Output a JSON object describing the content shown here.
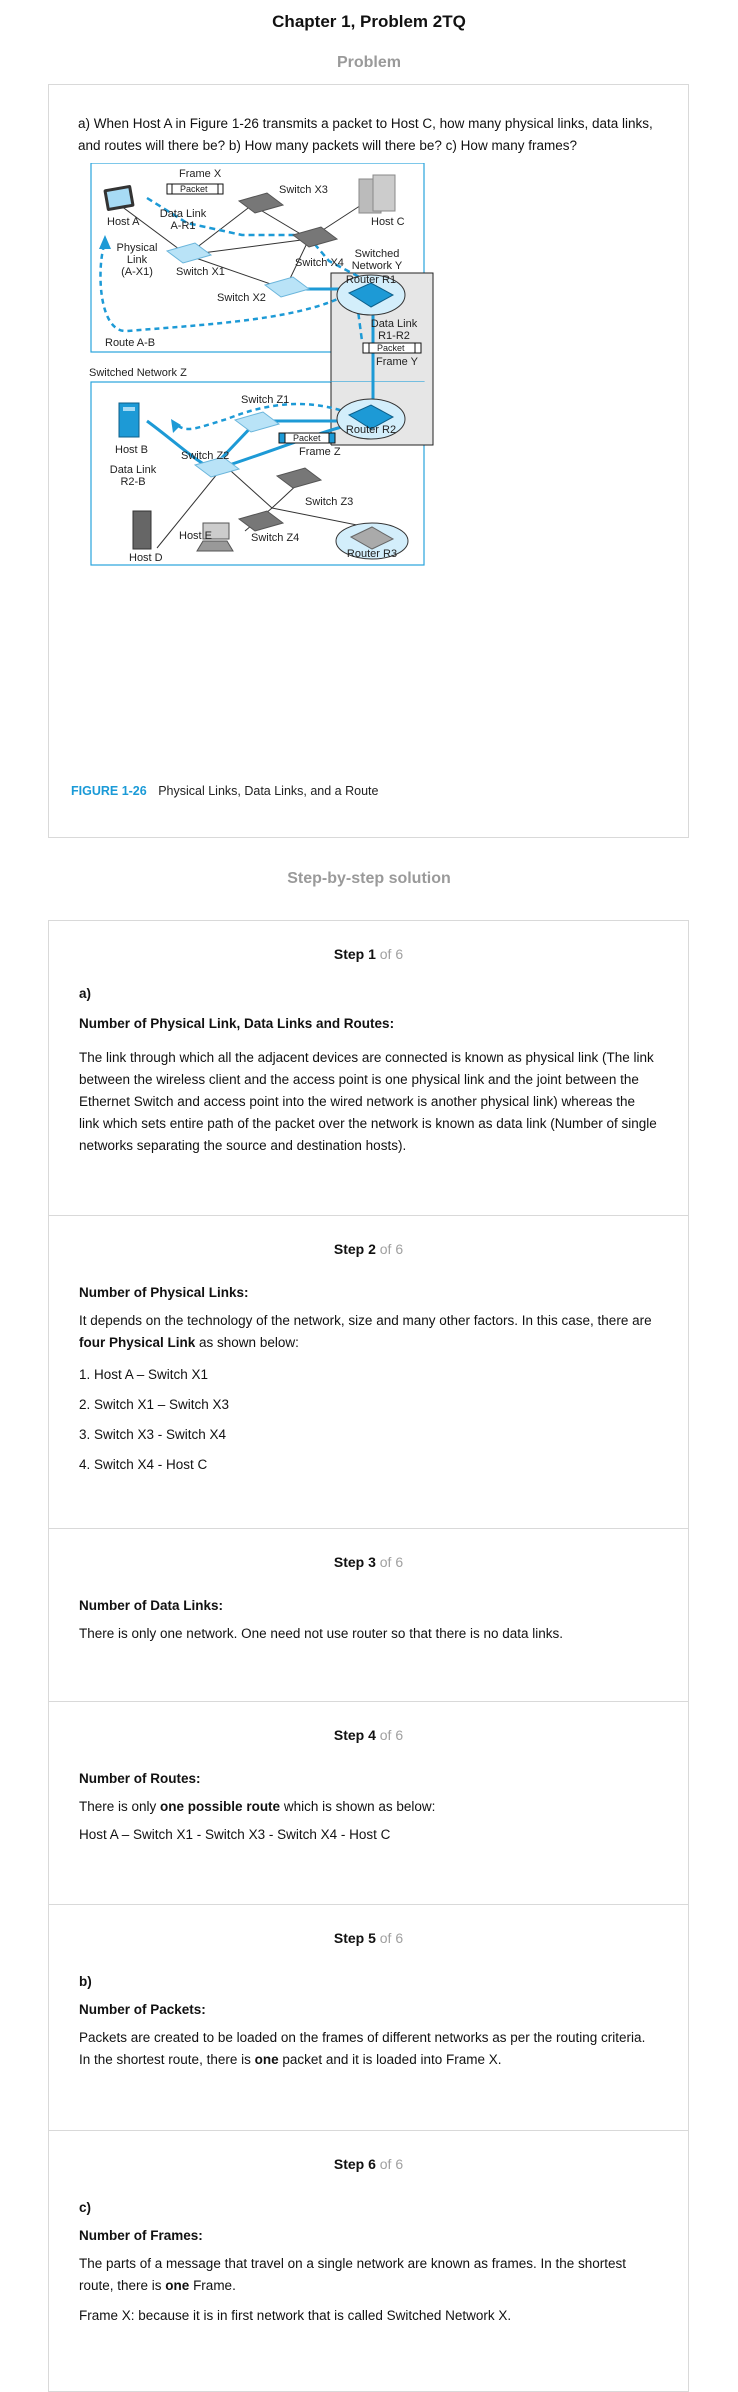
{
  "page_title": "Chapter 1, Problem 2TQ",
  "problem_heading": "Problem",
  "problem_text": "a) When Host A in Figure 1-26 transmits a packet to Host C, how many physical links, data links, and routes will there be? b) How many packets will there be? c) How many frames?",
  "figure": {
    "caption_number": "FIGURE 1-26",
    "caption_text": "Physical Links, Data Links, and a Route",
    "labels": {
      "frame_x": "Frame X",
      "packet": "Packet",
      "switch_x3": "Switch X3",
      "host_c": "Host C",
      "host_a": "Host A",
      "data_link_ar1_l1": "Data Link",
      "data_link_ar1_l2": "A-R1",
      "physical_link_l1": "Physical",
      "physical_link_l2": "Link",
      "physical_link_l3": "(A-X1)",
      "switch_x1": "Switch X1",
      "switch_x4": "Switch X4",
      "switched_network_y_l1": "Switched",
      "switched_network_y_l2": "Network Y",
      "router_r1": "Router R1",
      "switch_x2": "Switch X2",
      "data_link_r1r2_l1": "Data Link",
      "data_link_r1r2_l2": "R1-R2",
      "frame_y": "Frame Y",
      "route_ab": "Route A-B",
      "switched_network_z": "Switched Network Z",
      "switch_z1": "Switch Z1",
      "router_r2": "Router R2",
      "host_b": "Host B",
      "switch_z2": "Switch Z2",
      "frame_z": "Frame Z",
      "data_link_r2b_l1": "Data Link",
      "data_link_r2b_l2": "R2-B",
      "switch_z3": "Switch Z3",
      "host_e": "Host E",
      "switch_z4": "Switch Z4",
      "host_d": "Host D",
      "router_r3": "Router R3"
    }
  },
  "solution_heading": "Step-by-step solution",
  "step_of": "of 6",
  "steps": [
    {
      "title": "Step 1",
      "part": "a)",
      "heading": "Number of Physical Link, Data Links and Routes:",
      "text": "The link through which all the adjacent devices are connected is known as physical link (The link between the wireless client and the access point is one physical link and the joint between the Ethernet Switch and access point into the wired network is another physical link) whereas the link which sets entire path of the packet over the network is known as data link (Number of single networks separating the source and destination hosts)."
    },
    {
      "title": "Step 2",
      "heading": "Number of Physical Links:",
      "text_before": "It depends on the technology of the network, size and many other factors. In this case, there are ",
      "text_bold": "four Physical Link",
      "text_after": " as shown below:",
      "items": [
        "1. Host A – Switch X1",
        "2. Switch X1 – Switch X3",
        "3. Switch X3 - Switch X4",
        "4. Switch X4 - Host C"
      ]
    },
    {
      "title": "Step 3",
      "heading": "Number of Data Links:",
      "text": "There is only one network. One need not use router so that there is no data links."
    },
    {
      "title": "Step 4",
      "heading": "Number of Routes:",
      "text_before": "There is only ",
      "text_bold": "one possible route",
      "text_after": " which is shown as below:",
      "route": "Host A – Switch X1 - Switch X3 - Switch X4 - Host C"
    },
    {
      "title": "Step 5",
      "part": "b)",
      "heading": "Number of Packets:",
      "text_before": "Packets are created to be loaded on the frames of different networks as per the routing criteria. In the shortest route, there is ",
      "text_bold": "one",
      "text_after": " packet and it is loaded into Frame X."
    },
    {
      "title": "Step 6",
      "part": "c)",
      "heading": "Number of Frames:",
      "text_before": "The parts of a message that travel on a single network are known as frames. In the shortest route, there is ",
      "text_bold": "one",
      "text_after": " Frame.",
      "text2": "Frame X: because it is in first network that is called Switched Network X."
    }
  ]
}
